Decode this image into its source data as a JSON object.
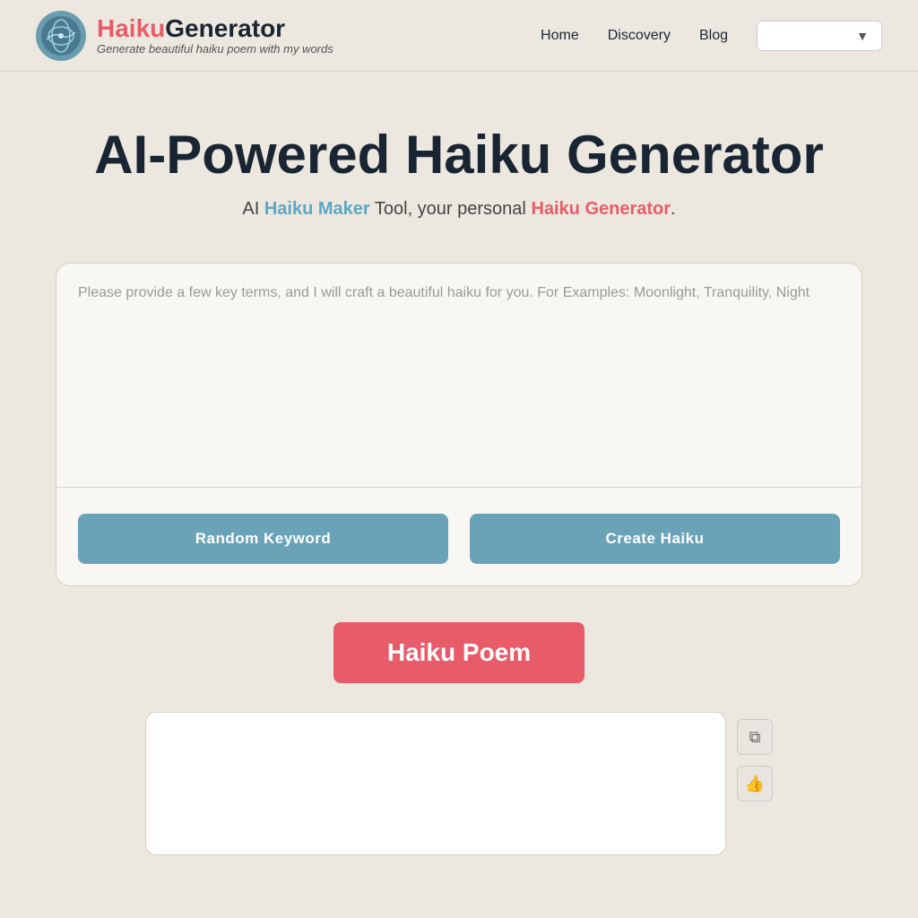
{
  "header": {
    "logo": {
      "haiku_text": "Haiku",
      "generator_text": "Generator",
      "subtitle": "Generate beautiful haiku poem with my words"
    },
    "nav": {
      "home_label": "Home",
      "discovery_label": "Discovery",
      "blog_label": "Blog",
      "dropdown_placeholder": ""
    }
  },
  "main": {
    "page_title": "AI-Powered Haiku Generator",
    "subtitle_prefix": "AI ",
    "subtitle_haiku_maker": "Haiku Maker",
    "subtitle_middle": " Tool, your personal ",
    "subtitle_haiku_gen": "Haiku Generator",
    "subtitle_suffix": ".",
    "textarea_placeholder": "Please provide a few key terms, and I will craft a beautiful haiku for you. For Examples: Moonlight, Tranquility, Night",
    "btn_random": "Random Keyword",
    "btn_create": "Create Haiku",
    "haiku_poem_banner": "Haiku Poem",
    "copy_icon": "⧉",
    "like_icon": "👍"
  }
}
